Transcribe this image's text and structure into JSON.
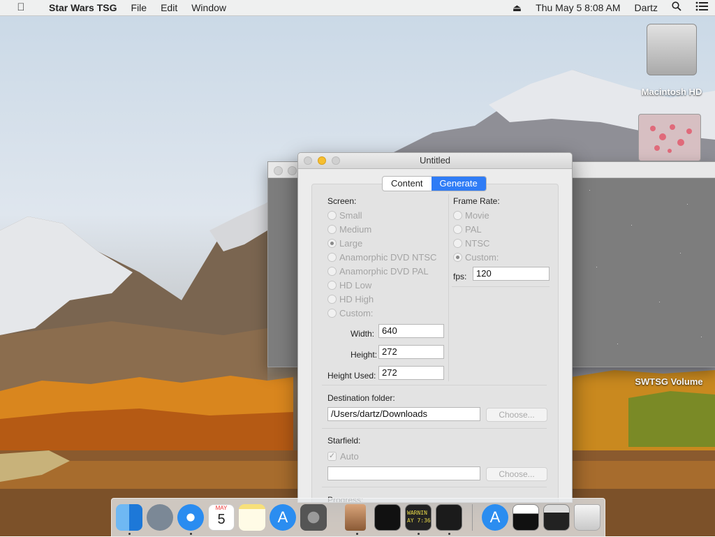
{
  "menubar": {
    "apple_icon": "apple-icon",
    "app_name": "Star Wars TSG",
    "menus": [
      "File",
      "Edit",
      "Window"
    ],
    "status": {
      "datetime": "Thu May 5  8:08 AM",
      "user": "Dartz"
    }
  },
  "desktop": {
    "icons": [
      {
        "label": "Macintosh HD",
        "icon": "hard-drive-icon"
      },
      {
        "label": "SWTSG Volume",
        "icon": "disk-image-icon"
      }
    ]
  },
  "window": {
    "title": "Untitled",
    "tabs": [
      {
        "label": "Content",
        "selected": false
      },
      {
        "label": "Generate",
        "selected": true
      }
    ],
    "screen": {
      "label": "Screen:",
      "options": [
        {
          "label": "Small",
          "selected": false
        },
        {
          "label": "Medium",
          "selected": false
        },
        {
          "label": "Large",
          "selected": true
        },
        {
          "label": "Anamorphic DVD NTSC",
          "selected": false
        },
        {
          "label": "Anamorphic DVD PAL",
          "selected": false
        },
        {
          "label": "HD Low",
          "selected": false
        },
        {
          "label": "HD High",
          "selected": false
        },
        {
          "label": "Custom:",
          "selected": false
        }
      ],
      "width_label": "Width:",
      "width_value": "640",
      "height_label": "Height:",
      "height_value": "272",
      "height_used_label": "Height Used:",
      "height_used_value": "272"
    },
    "frame_rate": {
      "label": "Frame Rate:",
      "options": [
        {
          "label": "Movie",
          "selected": false
        },
        {
          "label": "PAL",
          "selected": false
        },
        {
          "label": "NTSC",
          "selected": false
        },
        {
          "label": "Custom:",
          "selected": true
        }
      ],
      "fps_label": "fps:",
      "fps_value": "120"
    },
    "destination": {
      "label": "Destination folder:",
      "path": "/Users/dartz/Downloads",
      "choose": "Choose..."
    },
    "starfield": {
      "label": "Starfield:",
      "auto_label": "Auto",
      "auto_checked": true,
      "path": "",
      "choose": "Choose..."
    },
    "progress_label": "Progress:"
  },
  "dock": {
    "apps": [
      {
        "name": "finder-icon",
        "running": true
      },
      {
        "name": "launchpad-icon",
        "running": false
      },
      {
        "name": "safari-icon",
        "running": true
      },
      {
        "name": "calendar-icon",
        "running": false,
        "day": "5",
        "month": "MAY"
      },
      {
        "name": "notes-icon",
        "running": false
      },
      {
        "name": "app-store-icon",
        "running": false
      },
      {
        "name": "system-preferences-icon",
        "running": false
      },
      {
        "name": "star-wars-tsg-icon",
        "running": true
      },
      {
        "name": "exec-icon",
        "running": false
      },
      {
        "name": "console-icon",
        "running": true,
        "text": "WARNIN\nAY 7:36"
      },
      {
        "name": "script-editor-icon",
        "running": true
      },
      {
        "name": "app-store-downloads-icon",
        "running": false
      },
      {
        "name": "folder-icon",
        "running": false
      },
      {
        "name": "display-icon",
        "running": false
      },
      {
        "name": "trash-icon",
        "running": false
      }
    ]
  }
}
